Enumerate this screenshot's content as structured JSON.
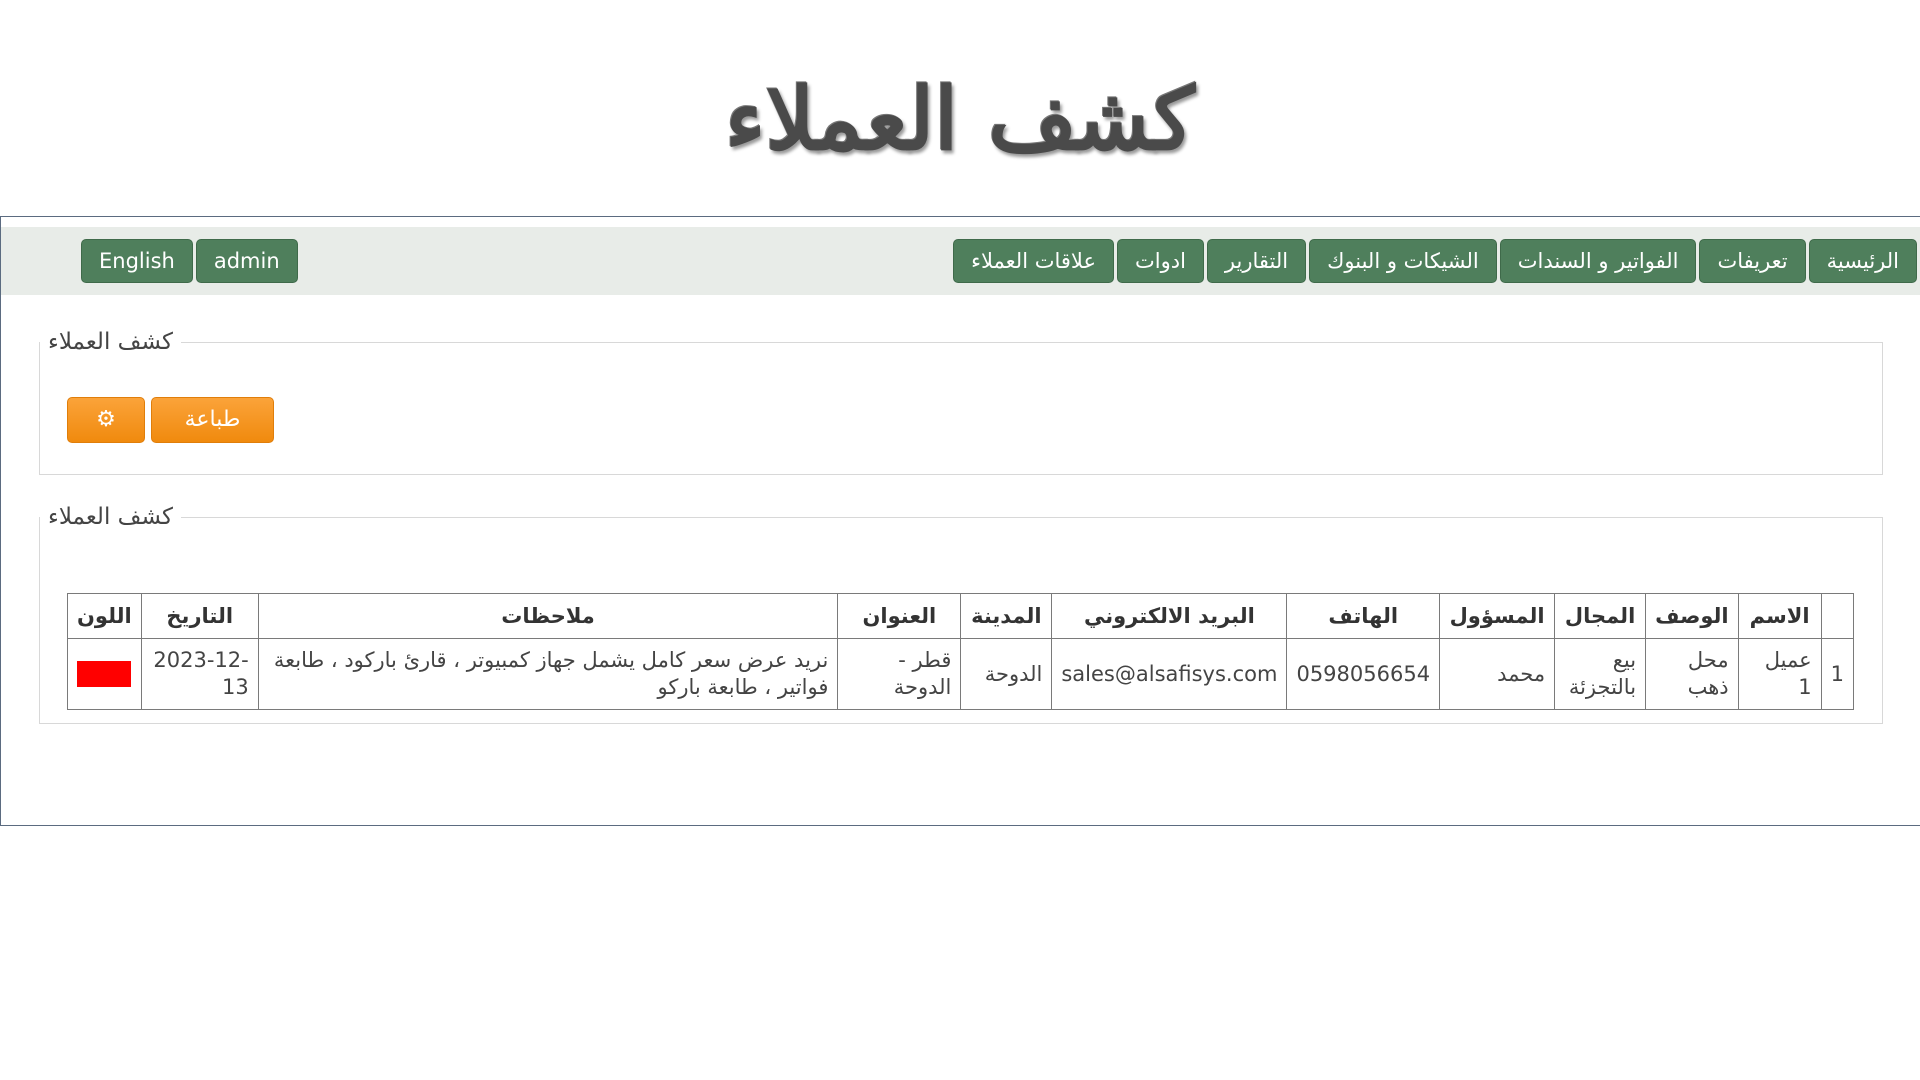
{
  "page": {
    "title": "كشف العملاء"
  },
  "nav": {
    "right_items": [
      "الرئيسية",
      "تعريفات",
      "الفواتير و السندات",
      "الشيكات و البنوك",
      "التقارير",
      "ادوات",
      "علاقات العملاء"
    ],
    "left_items": [
      "English",
      "admin"
    ]
  },
  "panel_controls": {
    "legend": "كشف العملاء",
    "print_label": "طباعة",
    "settings_icon": "gear-icon",
    "settings_glyph": "⚙"
  },
  "panel_table": {
    "legend": "كشف العملاء",
    "headers": {
      "index": "",
      "name": "الاسم",
      "description": "الوصف",
      "field": "المجال",
      "responsible": "المسؤول",
      "phone": "الهاتف",
      "email": "البريد الالكتروني",
      "city": "المدينة",
      "address": "العنوان",
      "notes": "ملاحظات",
      "date": "التاريخ",
      "color": "اللون"
    },
    "rows": [
      {
        "index": "1",
        "name": "عميل 1",
        "description": "محل ذهب",
        "field": "بيع بالتجزئة",
        "responsible": "محمد",
        "phone": "0598056654",
        "email": "sales@alsafisys.com",
        "city": "الدوحة",
        "address": "قطر - الدوحة",
        "notes": "نريد عرض سعر كامل يشمل جهاز كمبيوتر ، قارئ باركود ، طابعة فواتير ، طابعة باركو",
        "date": "2023-12-13",
        "color": "#ff0000"
      }
    ]
  }
}
